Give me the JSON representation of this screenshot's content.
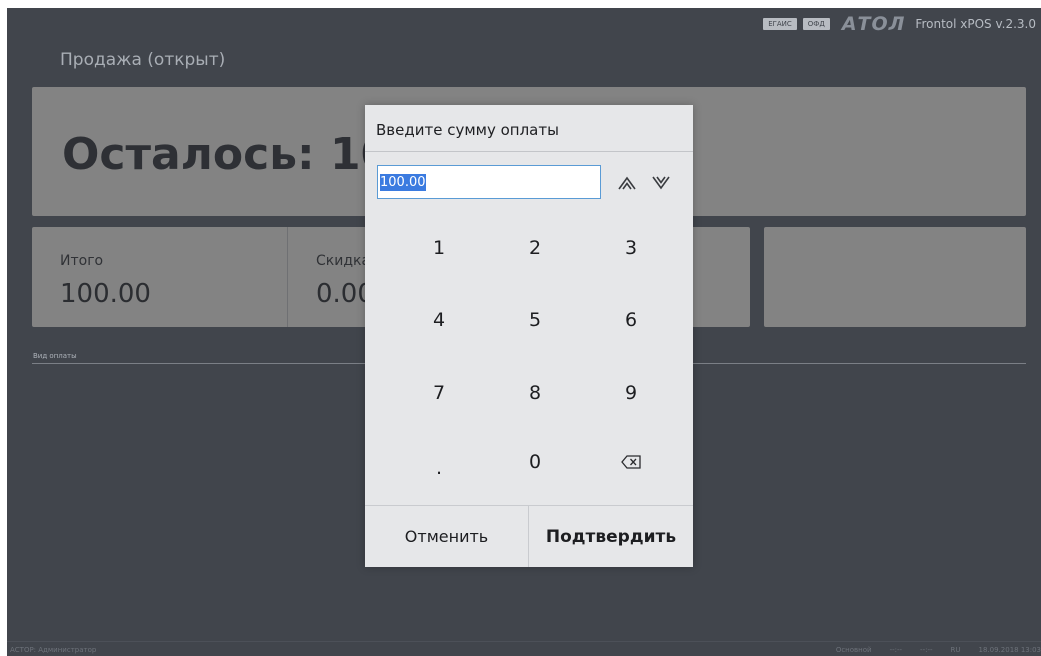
{
  "header": {
    "badges": [
      "ЕГАИС",
      "ОФД"
    ],
    "brand": "АТОЛ",
    "version": "Frontol xPOS v.2.3.0"
  },
  "sale": {
    "title": "Продажа (открыт)",
    "remaining_text": "Осталось: 100.00"
  },
  "totals": [
    {
      "label": "Итого",
      "value": "100.00"
    },
    {
      "label": "Скидка",
      "value": "0.00"
    },
    {
      "label": "",
      "value": ""
    }
  ],
  "payment_type_label": "Вид оплаты",
  "status": {
    "left": "АСТОР: Администратор",
    "right": [
      "Основной",
      "--:--",
      "--:--",
      "RU",
      "18.09.2018 13:03"
    ]
  },
  "dialog": {
    "title": "Введите сумму оплаты",
    "amount_value": "100.00",
    "keys": [
      "1",
      "2",
      "3",
      "4",
      "5",
      "6",
      "7",
      "8",
      "9",
      ".",
      "0",
      "backspace"
    ],
    "cancel_label": "Отменить",
    "confirm_label": "Подтвердить"
  },
  "icons": {
    "up": "arrow-up-icon",
    "down": "arrow-down-icon",
    "backspace": "backspace-icon"
  }
}
